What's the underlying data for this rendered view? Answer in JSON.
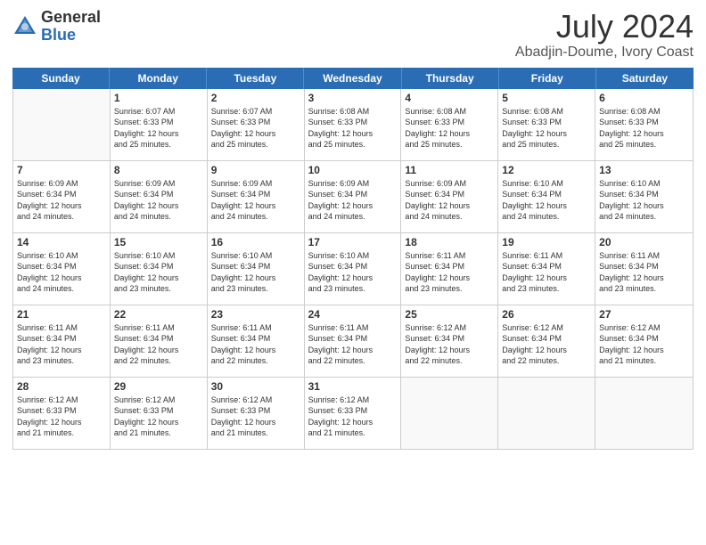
{
  "logo": {
    "general": "General",
    "blue": "Blue"
  },
  "title": "July 2024",
  "subtitle": "Abadjin-Doume, Ivory Coast",
  "days_of_week": [
    "Sunday",
    "Monday",
    "Tuesday",
    "Wednesday",
    "Thursday",
    "Friday",
    "Saturday"
  ],
  "weeks": [
    [
      {
        "day": "",
        "info": ""
      },
      {
        "day": "1",
        "info": "Sunrise: 6:07 AM\nSunset: 6:33 PM\nDaylight: 12 hours\nand 25 minutes."
      },
      {
        "day": "2",
        "info": "Sunrise: 6:07 AM\nSunset: 6:33 PM\nDaylight: 12 hours\nand 25 minutes."
      },
      {
        "day": "3",
        "info": "Sunrise: 6:08 AM\nSunset: 6:33 PM\nDaylight: 12 hours\nand 25 minutes."
      },
      {
        "day": "4",
        "info": "Sunrise: 6:08 AM\nSunset: 6:33 PM\nDaylight: 12 hours\nand 25 minutes."
      },
      {
        "day": "5",
        "info": "Sunrise: 6:08 AM\nSunset: 6:33 PM\nDaylight: 12 hours\nand 25 minutes."
      },
      {
        "day": "6",
        "info": "Sunrise: 6:08 AM\nSunset: 6:33 PM\nDaylight: 12 hours\nand 25 minutes."
      }
    ],
    [
      {
        "day": "7",
        "info": "Sunrise: 6:09 AM\nSunset: 6:34 PM\nDaylight: 12 hours\nand 24 minutes."
      },
      {
        "day": "8",
        "info": "Sunrise: 6:09 AM\nSunset: 6:34 PM\nDaylight: 12 hours\nand 24 minutes."
      },
      {
        "day": "9",
        "info": "Sunrise: 6:09 AM\nSunset: 6:34 PM\nDaylight: 12 hours\nand 24 minutes."
      },
      {
        "day": "10",
        "info": "Sunrise: 6:09 AM\nSunset: 6:34 PM\nDaylight: 12 hours\nand 24 minutes."
      },
      {
        "day": "11",
        "info": "Sunrise: 6:09 AM\nSunset: 6:34 PM\nDaylight: 12 hours\nand 24 minutes."
      },
      {
        "day": "12",
        "info": "Sunrise: 6:10 AM\nSunset: 6:34 PM\nDaylight: 12 hours\nand 24 minutes."
      },
      {
        "day": "13",
        "info": "Sunrise: 6:10 AM\nSunset: 6:34 PM\nDaylight: 12 hours\nand 24 minutes."
      }
    ],
    [
      {
        "day": "14",
        "info": "Sunrise: 6:10 AM\nSunset: 6:34 PM\nDaylight: 12 hours\nand 24 minutes."
      },
      {
        "day": "15",
        "info": "Sunrise: 6:10 AM\nSunset: 6:34 PM\nDaylight: 12 hours\nand 23 minutes."
      },
      {
        "day": "16",
        "info": "Sunrise: 6:10 AM\nSunset: 6:34 PM\nDaylight: 12 hours\nand 23 minutes."
      },
      {
        "day": "17",
        "info": "Sunrise: 6:10 AM\nSunset: 6:34 PM\nDaylight: 12 hours\nand 23 minutes."
      },
      {
        "day": "18",
        "info": "Sunrise: 6:11 AM\nSunset: 6:34 PM\nDaylight: 12 hours\nand 23 minutes."
      },
      {
        "day": "19",
        "info": "Sunrise: 6:11 AM\nSunset: 6:34 PM\nDaylight: 12 hours\nand 23 minutes."
      },
      {
        "day": "20",
        "info": "Sunrise: 6:11 AM\nSunset: 6:34 PM\nDaylight: 12 hours\nand 23 minutes."
      }
    ],
    [
      {
        "day": "21",
        "info": "Sunrise: 6:11 AM\nSunset: 6:34 PM\nDaylight: 12 hours\nand 23 minutes."
      },
      {
        "day": "22",
        "info": "Sunrise: 6:11 AM\nSunset: 6:34 PM\nDaylight: 12 hours\nand 22 minutes."
      },
      {
        "day": "23",
        "info": "Sunrise: 6:11 AM\nSunset: 6:34 PM\nDaylight: 12 hours\nand 22 minutes."
      },
      {
        "day": "24",
        "info": "Sunrise: 6:11 AM\nSunset: 6:34 PM\nDaylight: 12 hours\nand 22 minutes."
      },
      {
        "day": "25",
        "info": "Sunrise: 6:12 AM\nSunset: 6:34 PM\nDaylight: 12 hours\nand 22 minutes."
      },
      {
        "day": "26",
        "info": "Sunrise: 6:12 AM\nSunset: 6:34 PM\nDaylight: 12 hours\nand 22 minutes."
      },
      {
        "day": "27",
        "info": "Sunrise: 6:12 AM\nSunset: 6:34 PM\nDaylight: 12 hours\nand 21 minutes."
      }
    ],
    [
      {
        "day": "28",
        "info": "Sunrise: 6:12 AM\nSunset: 6:33 PM\nDaylight: 12 hours\nand 21 minutes."
      },
      {
        "day": "29",
        "info": "Sunrise: 6:12 AM\nSunset: 6:33 PM\nDaylight: 12 hours\nand 21 minutes."
      },
      {
        "day": "30",
        "info": "Sunrise: 6:12 AM\nSunset: 6:33 PM\nDaylight: 12 hours\nand 21 minutes."
      },
      {
        "day": "31",
        "info": "Sunrise: 6:12 AM\nSunset: 6:33 PM\nDaylight: 12 hours\nand 21 minutes."
      },
      {
        "day": "",
        "info": ""
      },
      {
        "day": "",
        "info": ""
      },
      {
        "day": "",
        "info": ""
      }
    ]
  ]
}
